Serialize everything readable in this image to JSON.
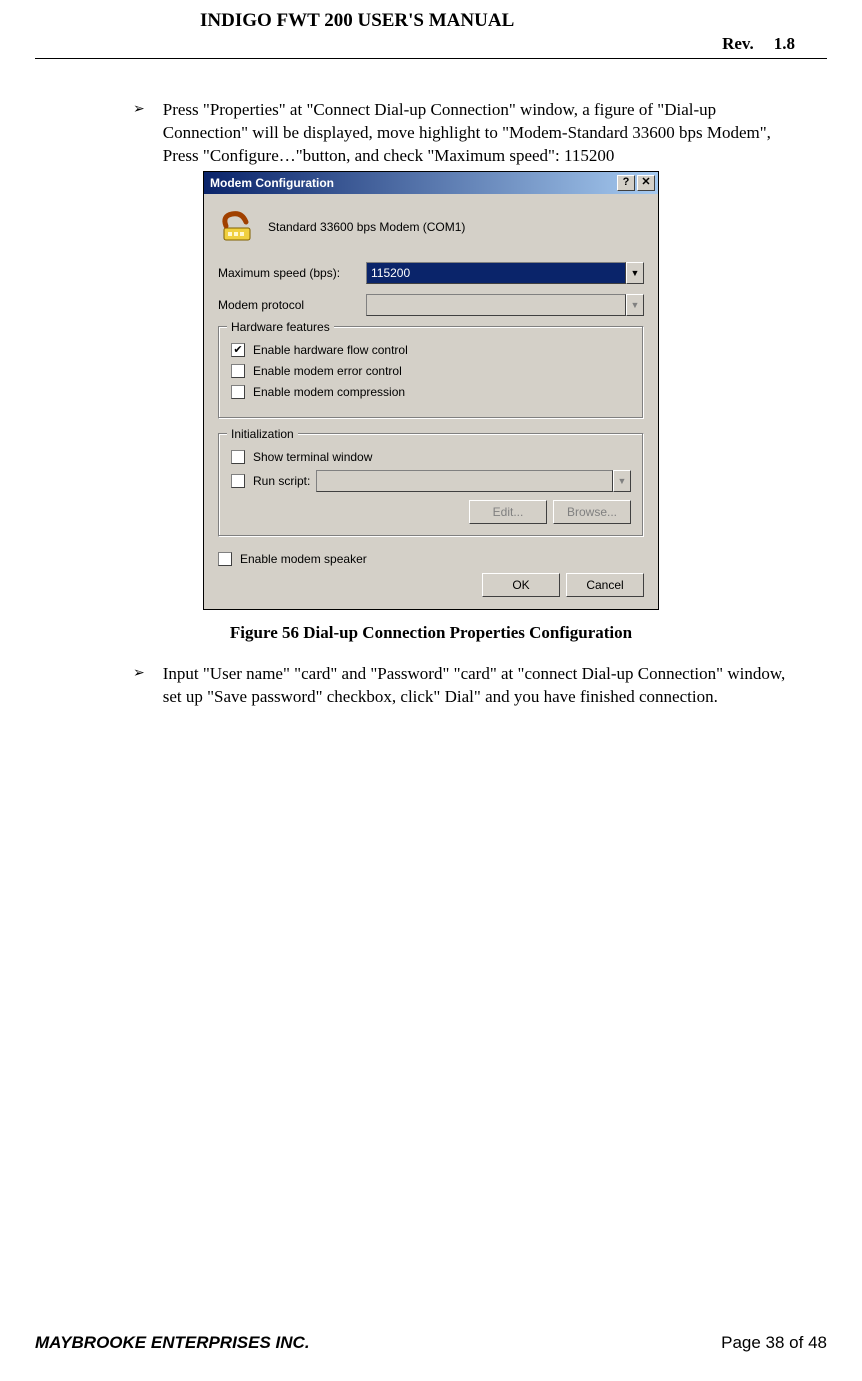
{
  "header": {
    "title": "INDIGO FWT 200 USER'S MANUAL",
    "rev_label": "Rev.",
    "rev_value": "1.8"
  },
  "bullets": {
    "mark": "➢",
    "item1": "Press \"Properties\" at \"Connect Dial-up Connection\" window, a figure of \"Dial-up Connection\" will be displayed, move highlight to \"Modem-Standard 33600 bps Modem\", Press \"Configure…\"button, and check \"Maximum speed\": 115200",
    "item2": "Input \"User name\" \"card\" and \"Password\" \"card\" at \"connect Dial-up Connection\" window, set up \"Save password\" checkbox, click\" Dial\" and you have finished connection."
  },
  "dialog": {
    "title": "Modem Configuration",
    "help_icon": "?",
    "close_icon": "✕",
    "modem_name": "Standard 33600 bps Modem (COM1)",
    "max_speed_label": "Maximum speed (bps):",
    "max_speed_value": "115200",
    "modem_protocol_label": "Modem protocol",
    "dropdown_arrow": "▼",
    "group_hw": "Hardware features",
    "check_marked": "✔",
    "chk_hw_flow": "Enable hardware flow control",
    "chk_err": "Enable modem error control",
    "chk_comp": "Enable modem compression",
    "group_init": "Initialization",
    "chk_term": "Show terminal window",
    "chk_script": "Run script:",
    "btn_edit": "Edit...",
    "btn_browse": "Browse...",
    "chk_speaker": "Enable modem speaker",
    "btn_ok": "OK",
    "btn_cancel": "Cancel"
  },
  "caption": "Figure 56 Dial-up Connection Properties Configuration",
  "footer": {
    "company": "MAYBROOKE ENTERPRISES INC.",
    "page": "Page 38 of 48"
  }
}
